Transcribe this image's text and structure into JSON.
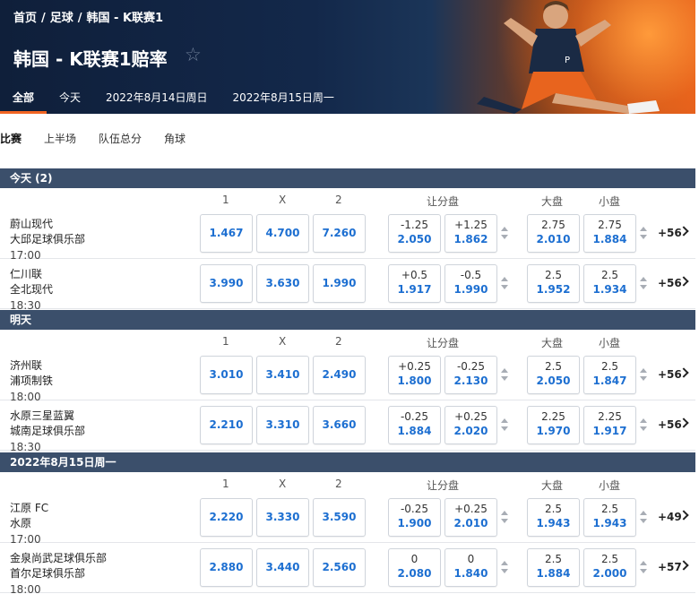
{
  "breadcrumb": [
    "首页",
    "足球",
    "韩国 - K联赛1"
  ],
  "breadcrumb_sep": "/",
  "page_title": "韩国 - K联赛1赔率",
  "favorite_star": "☆",
  "date_tabs": [
    "全部",
    "今天",
    "2022年8月14日周日",
    "2022年8月15日周一"
  ],
  "market_tabs": [
    "比赛",
    "上半场",
    "队伍总分",
    "角球"
  ],
  "columns": {
    "c1": "1",
    "cx": "X",
    "c2": "2",
    "handicap": "让分盘",
    "over": "大盘",
    "under": "小盘"
  },
  "colors": {
    "header_dark": "#0f1f3a",
    "accent": "#f26522",
    "section_bar": "#3b4f6b",
    "price": "#1d6fd1"
  },
  "sections": [
    {
      "title": "今天 (2)",
      "matches": [
        {
          "home": "蔚山现代",
          "away": "大邱足球俱乐部",
          "time": "17:00",
          "o1": "1.467",
          "ox": "4.700",
          "o2": "7.260",
          "h1_line": "-1.25",
          "h1_price": "2.050",
          "h2_line": "+1.25",
          "h2_price": "1.862",
          "ov_line": "2.75",
          "ov_price": "2.010",
          "un_line": "2.75",
          "un_price": "1.884",
          "more": "+56"
        },
        {
          "home": "仁川联",
          "away": "全北现代",
          "time": "18:30",
          "o1": "3.990",
          "ox": "3.630",
          "o2": "1.990",
          "h1_line": "+0.5",
          "h1_price": "1.917",
          "h2_line": "-0.5",
          "h2_price": "1.990",
          "ov_line": "2.5",
          "ov_price": "1.952",
          "un_line": "2.5",
          "un_price": "1.934",
          "more": "+56"
        }
      ]
    },
    {
      "title": "明天",
      "matches": [
        {
          "home": "济州联",
          "away": "浦项制铁",
          "time": "18:00",
          "o1": "3.010",
          "ox": "3.410",
          "o2": "2.490",
          "h1_line": "+0.25",
          "h1_price": "1.800",
          "h2_line": "-0.25",
          "h2_price": "2.130",
          "ov_line": "2.5",
          "ov_price": "2.050",
          "un_line": "2.5",
          "un_price": "1.847",
          "more": "+56"
        },
        {
          "home": "水原三星蓝翼",
          "away": "城南足球俱乐部",
          "time": "18:30",
          "o1": "2.210",
          "ox": "3.310",
          "o2": "3.660",
          "h1_line": "-0.25",
          "h1_price": "1.884",
          "h2_line": "+0.25",
          "h2_price": "2.020",
          "ov_line": "2.25",
          "ov_price": "1.970",
          "un_line": "2.25",
          "un_price": "1.917",
          "more": "+56"
        }
      ]
    },
    {
      "title": "2022年8月15日周一",
      "matches": [
        {
          "home": "江原 FC",
          "away": "水原",
          "time": "17:00",
          "o1": "2.220",
          "ox": "3.330",
          "o2": "3.590",
          "h1_line": "-0.25",
          "h1_price": "1.900",
          "h2_line": "+0.25",
          "h2_price": "2.010",
          "ov_line": "2.5",
          "ov_price": "1.943",
          "un_line": "2.5",
          "un_price": "1.943",
          "more": "+49"
        },
        {
          "home": "金泉尚武足球俱乐部",
          "away": "首尔足球俱乐部",
          "time": "18:00",
          "o1": "2.880",
          "ox": "3.440",
          "o2": "2.560",
          "h1_line": "0",
          "h1_price": "2.080",
          "h2_line": "0",
          "h2_price": "1.840",
          "ov_line": "2.5",
          "ov_price": "1.884",
          "un_line": "2.5",
          "un_price": "2.000",
          "more": "+57"
        }
      ]
    }
  ]
}
